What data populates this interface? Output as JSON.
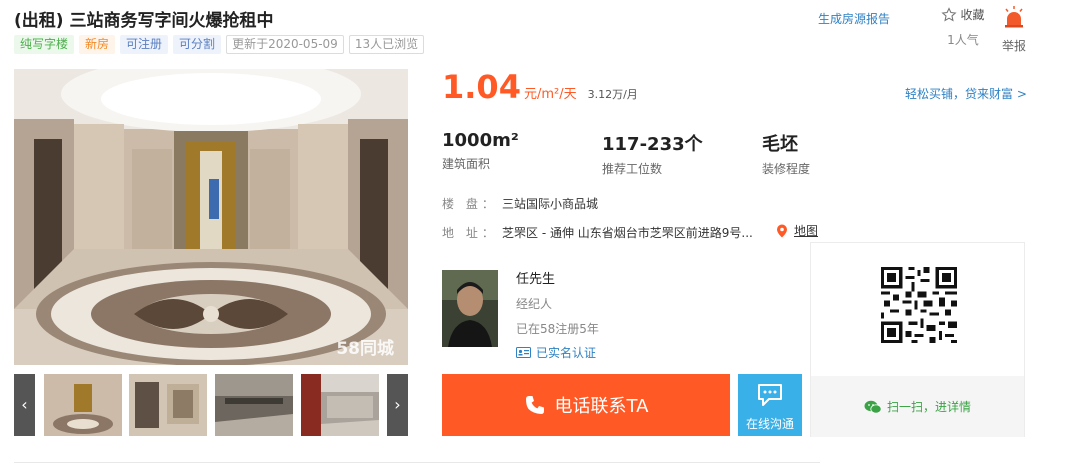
{
  "listing": {
    "title": "(出租) 三站商务写字间火爆抢租中",
    "tags": [
      {
        "text": "纯写字楼",
        "style": "green"
      },
      {
        "text": "新房",
        "style": "orange"
      },
      {
        "text": "可注册",
        "style": "blue"
      },
      {
        "text": "可分割",
        "style": "blue"
      },
      {
        "text": "更新于2020-05-09",
        "style": "gray"
      },
      {
        "text": "13人已浏览",
        "style": "gray"
      }
    ]
  },
  "actions": {
    "report_link": "生成房源报告",
    "favorite_label": "收藏",
    "favorite_count": "1人气",
    "report_label": "举报"
  },
  "gallery": {
    "watermark": "58同城",
    "prev": "‹",
    "next": "›"
  },
  "price": {
    "value": "1.04",
    "unit": "元/m²/天",
    "monthly": "3.12万/月",
    "loan_link": "轻松买铺，贷来财富 >"
  },
  "stats": [
    {
      "value": "1000m²",
      "label": "建筑面积"
    },
    {
      "value": "117-233个",
      "label": "推荐工位数"
    },
    {
      "value": "毛坯",
      "label": "装修程度"
    }
  ],
  "info": {
    "building_label": "楼 盘：",
    "building_value": "三站国际小商品城",
    "address_label": "地 址：",
    "address_value": "芝罘区 - 通伸  山东省烟台市芝罘区前进路9号...",
    "map_link": "地图"
  },
  "agent": {
    "name": "任先生",
    "role": "经纪人",
    "registered": "已在58注册5年",
    "verified": "已实名认证"
  },
  "contact": {
    "call_label": "电话联系TA",
    "chat_label": "在线沟通",
    "scan_label": "扫一扫，进详情"
  },
  "colors": {
    "accent": "#ff5a26",
    "link": "#2f82c4",
    "chat": "#3ab0e8",
    "wechat": "#3ba346"
  }
}
